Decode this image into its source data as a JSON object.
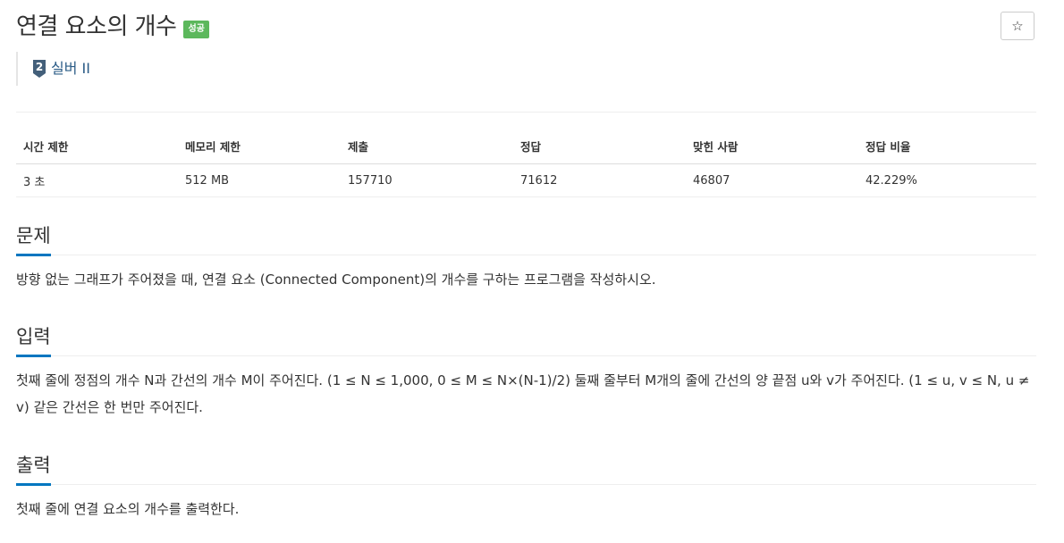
{
  "problem": {
    "title": "연결 요소의 개수",
    "badge": "성공",
    "tier": "실버 II",
    "tier_number": "2",
    "star_icon": "☆"
  },
  "info_table": {
    "headers": [
      "시간 제한",
      "메모리 제한",
      "제출",
      "정답",
      "맞힌 사람",
      "정답 비율"
    ],
    "values": [
      "3 초",
      "512 MB",
      "157710",
      "71612",
      "46807",
      "42.229%"
    ]
  },
  "sections": {
    "description": {
      "heading": "문제",
      "text": "방향 없는 그래프가 주어졌을 때, 연결 요소 (Connected Component)의 개수를 구하는 프로그램을 작성하시오."
    },
    "input": {
      "heading": "입력",
      "text": "첫째 줄에 정점의 개수 N과 간선의 개수 M이 주어진다. (1 ≤ N ≤ 1,000, 0 ≤ M ≤ N×(N-1)/2) 둘째 줄부터 M개의 줄에 간선의 양 끝점 u와 v가 주어진다. (1 ≤ u, v ≤ N, u ≠ v) 같은 간선은 한 번만 주어진다."
    },
    "output": {
      "heading": "출력",
      "text": "첫째 줄에 연결 요소의 개수를 출력한다."
    }
  },
  "colors": {
    "badge": "#5cb85c",
    "tier": "#2a5b86",
    "section_underline": "#0076c0"
  }
}
